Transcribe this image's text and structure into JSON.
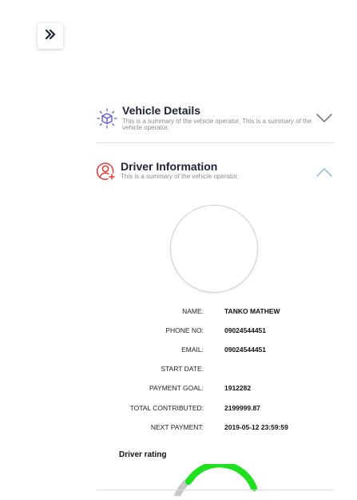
{
  "sidebar": {
    "expand_icon": "double-chevron-right-icon"
  },
  "vehicle_section": {
    "title": "Vehicle Details",
    "subtitle": "This is a summary of the vehicle operator, This is a summary of the vehicle operator.",
    "icon": "cube-icon",
    "accent": "#5b5bd6",
    "expanded": false
  },
  "driver_section": {
    "title": "Driver Information",
    "subtitle": "This is a summary of the vehicle operator.",
    "icon": "user-add-icon",
    "accent": "#e53935",
    "expanded": true
  },
  "driver_info": [
    {
      "label": "NAME:",
      "value": "TANKO MATHEW"
    },
    {
      "label": "PHONE NO:",
      "value": "09024544451"
    },
    {
      "label": "EMAIL:",
      "value": "09024544451"
    },
    {
      "label": "START DATE:",
      "value": ""
    },
    {
      "label": "PAYMENT GOAL:",
      "value": "1912282"
    },
    {
      "label": "TOTAL CONTRIBUTED:",
      "value": "2199999.87"
    },
    {
      "label": "NEXT PAYMENT:",
      "value": "2019-05-12 23:59:59"
    }
  ],
  "rating": {
    "title": "Driver rating",
    "gauge_color": "#1ee01e",
    "track_color": "#c8c8c8"
  }
}
